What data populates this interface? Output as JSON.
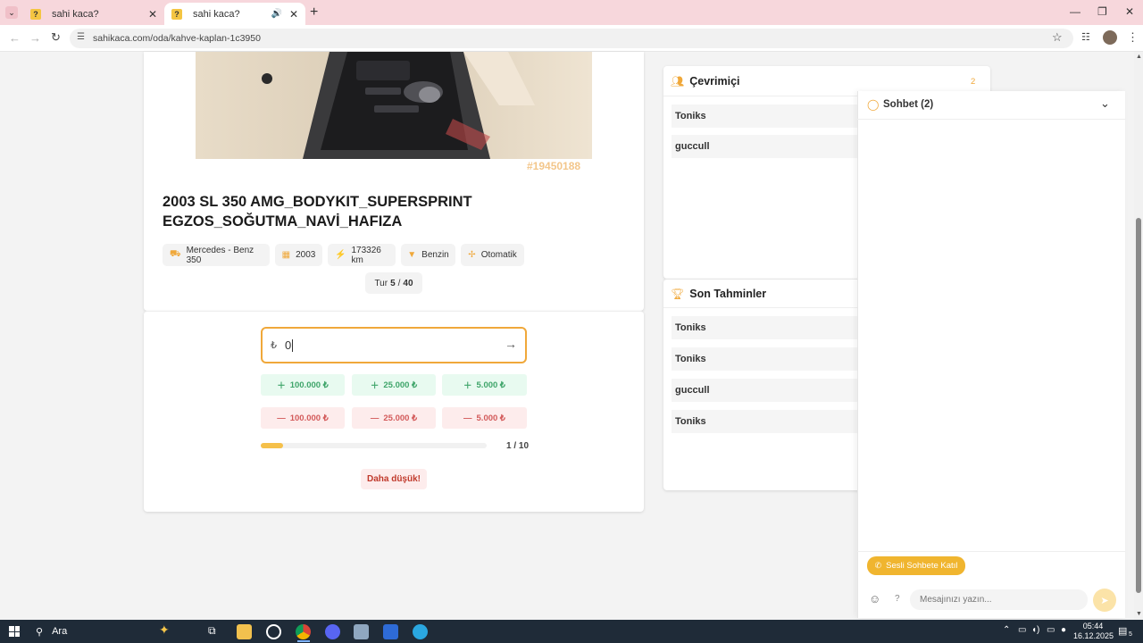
{
  "browser": {
    "tabs": [
      {
        "title": "sahi kaca?",
        "active": false
      },
      {
        "title": "sahi kaca?",
        "active": true
      }
    ],
    "url": "sahikaca.com/oda/kahve-kaplan-1c3950"
  },
  "listing": {
    "id": "#19450188",
    "title_line1": "2003 SL 350 AMG_BODYKIT_SUPERSPRINT",
    "title_line2": "EGZOS_SOĞUTMA_NAVİ_HAFIZA",
    "chips": {
      "brand": "Mercedes - Benz 350",
      "year": "2003",
      "km": "173326 km",
      "fuel": "Benzin",
      "gear": "Otomatik"
    },
    "round_label": "Tur",
    "round_current": "5",
    "round_sep": "/",
    "round_total": "40"
  },
  "guess": {
    "currency": "₺",
    "value": "0",
    "plus_buttons": [
      "100.000 ₺",
      "25.000 ₺",
      "5.000 ₺"
    ],
    "minus_buttons": [
      "100.000 ₺",
      "25.000 ₺",
      "5.000 ₺"
    ],
    "progress": 0.1,
    "progress_text": "1 / 10",
    "hint": "Daha düşük!"
  },
  "online": {
    "title": "Çevrimiçi",
    "count": "2",
    "users": [
      "Toniks",
      "guccull"
    ]
  },
  "recent": {
    "title": "Son Tahminler",
    "users": [
      "Toniks",
      "Toniks",
      "guccull",
      "Toniks"
    ]
  },
  "chat": {
    "title": "Sohbet (2)",
    "voice_button": "Sesli Sohbete Katıl",
    "help": "?",
    "placeholder": "Mesajınızı yazın..."
  },
  "taskbar": {
    "search": "Ara",
    "time": "05:44",
    "date": "16.12.2025",
    "notif_count": "5"
  },
  "colors": {
    "accent": "#f0a83a",
    "tabbar": "#f7d7dc",
    "plus": "#3fa56a",
    "minus": "#d35b5b"
  }
}
